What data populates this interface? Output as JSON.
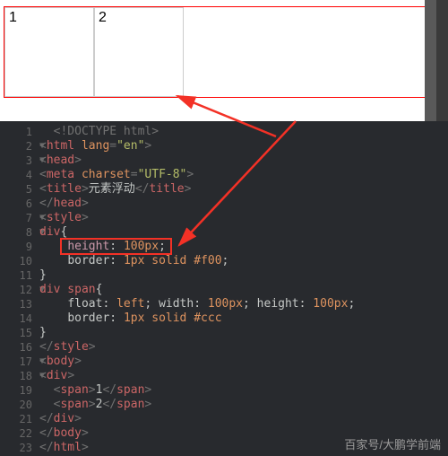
{
  "preview": {
    "span1": "1",
    "span2": "2"
  },
  "watermark": "百家号/大鹏学前端",
  "fold_glyph": "▼",
  "code": [
    {
      "n": 1,
      "fold": false,
      "tokens": [
        [
          "  ",
          "text"
        ],
        [
          "<!DOCTYPE html>",
          "doctype"
        ]
      ]
    },
    {
      "n": 2,
      "fold": true,
      "tokens": [
        [
          "<",
          "angle"
        ],
        [
          "html",
          "tag"
        ],
        [
          " ",
          "text"
        ],
        [
          "lang",
          "attr"
        ],
        [
          "=",
          "angle"
        ],
        [
          "\"en\"",
          "string"
        ],
        [
          ">",
          "angle"
        ]
      ]
    },
    {
      "n": 3,
      "fold": true,
      "tokens": [
        [
          "<",
          "angle"
        ],
        [
          "head",
          "tag"
        ],
        [
          ">",
          "angle"
        ]
      ]
    },
    {
      "n": 4,
      "fold": false,
      "tokens": [
        [
          "<",
          "angle"
        ],
        [
          "meta",
          "tag"
        ],
        [
          " ",
          "text"
        ],
        [
          "charset",
          "attr"
        ],
        [
          "=",
          "angle"
        ],
        [
          "\"UTF-8\"",
          "string"
        ],
        [
          ">",
          "angle"
        ]
      ]
    },
    {
      "n": 5,
      "fold": false,
      "tokens": [
        [
          "<",
          "angle"
        ],
        [
          "title",
          "tag"
        ],
        [
          ">",
          "angle"
        ],
        [
          "元素浮动",
          "text"
        ],
        [
          "</",
          "angle"
        ],
        [
          "title",
          "tag"
        ],
        [
          ">",
          "angle"
        ]
      ]
    },
    {
      "n": 6,
      "fold": false,
      "tokens": [
        [
          "</",
          "angle"
        ],
        [
          "head",
          "tag"
        ],
        [
          ">",
          "angle"
        ]
      ]
    },
    {
      "n": 7,
      "fold": true,
      "tokens": [
        [
          "<",
          "angle"
        ],
        [
          "style",
          "tag"
        ],
        [
          ">",
          "angle"
        ]
      ]
    },
    {
      "n": 8,
      "fold": true,
      "tokens": [
        [
          "div",
          "sel"
        ],
        [
          "{",
          "text"
        ]
      ]
    },
    {
      "n": 9,
      "fold": false,
      "tokens": [
        [
          "    ",
          "text"
        ],
        [
          "height",
          "pink"
        ],
        [
          ": ",
          "text"
        ],
        [
          "100px",
          "val"
        ],
        [
          ";",
          "text"
        ]
      ]
    },
    {
      "n": 10,
      "fold": false,
      "tokens": [
        [
          "    ",
          "text"
        ],
        [
          "border",
          "prop"
        ],
        [
          ": ",
          "text"
        ],
        [
          "1px",
          "val"
        ],
        [
          " ",
          "text"
        ],
        [
          "solid",
          "val"
        ],
        [
          " ",
          "text"
        ],
        [
          "#f00",
          "val"
        ],
        [
          ";",
          "text"
        ]
      ]
    },
    {
      "n": 11,
      "fold": false,
      "tokens": [
        [
          "}",
          "text"
        ]
      ]
    },
    {
      "n": 12,
      "fold": true,
      "tokens": [
        [
          "div span",
          "sel"
        ],
        [
          "{",
          "text"
        ]
      ]
    },
    {
      "n": 13,
      "fold": false,
      "tokens": [
        [
          "    ",
          "text"
        ],
        [
          "float",
          "prop"
        ],
        [
          ": ",
          "text"
        ],
        [
          "left",
          "val"
        ],
        [
          "; ",
          "text"
        ],
        [
          "width",
          "prop"
        ],
        [
          ": ",
          "text"
        ],
        [
          "100px",
          "val"
        ],
        [
          "; ",
          "text"
        ],
        [
          "height",
          "prop"
        ],
        [
          ": ",
          "text"
        ],
        [
          "100px",
          "val"
        ],
        [
          ";",
          "text"
        ]
      ]
    },
    {
      "n": 14,
      "fold": false,
      "tokens": [
        [
          "    ",
          "text"
        ],
        [
          "border",
          "prop"
        ],
        [
          ": ",
          "text"
        ],
        [
          "1px",
          "val"
        ],
        [
          " ",
          "text"
        ],
        [
          "solid",
          "val"
        ],
        [
          " ",
          "text"
        ],
        [
          "#ccc",
          "val"
        ]
      ]
    },
    {
      "n": 15,
      "fold": false,
      "tokens": [
        [
          "}",
          "text"
        ]
      ]
    },
    {
      "n": 16,
      "fold": false,
      "tokens": [
        [
          "</",
          "angle"
        ],
        [
          "style",
          "tag"
        ],
        [
          ">",
          "angle"
        ]
      ]
    },
    {
      "n": 17,
      "fold": true,
      "tokens": [
        [
          "<",
          "angle"
        ],
        [
          "body",
          "tag"
        ],
        [
          ">",
          "angle"
        ]
      ]
    },
    {
      "n": 18,
      "fold": true,
      "tokens": [
        [
          "<",
          "angle"
        ],
        [
          "div",
          "tag"
        ],
        [
          ">",
          "angle"
        ]
      ]
    },
    {
      "n": 19,
      "fold": false,
      "tokens": [
        [
          "  ",
          "text"
        ],
        [
          "<",
          "angle"
        ],
        [
          "span",
          "tag"
        ],
        [
          ">",
          "angle"
        ],
        [
          "1",
          "text"
        ],
        [
          "</",
          "angle"
        ],
        [
          "span",
          "tag"
        ],
        [
          ">",
          "angle"
        ]
      ]
    },
    {
      "n": 20,
      "fold": false,
      "tokens": [
        [
          "  ",
          "text"
        ],
        [
          "<",
          "angle"
        ],
        [
          "span",
          "tag"
        ],
        [
          ">",
          "angle"
        ],
        [
          "2",
          "text"
        ],
        [
          "</",
          "angle"
        ],
        [
          "span",
          "tag"
        ],
        [
          ">",
          "angle"
        ]
      ]
    },
    {
      "n": 21,
      "fold": false,
      "tokens": [
        [
          "</",
          "angle"
        ],
        [
          "div",
          "tag"
        ],
        [
          ">",
          "angle"
        ]
      ]
    },
    {
      "n": 22,
      "fold": false,
      "tokens": [
        [
          "</",
          "angle"
        ],
        [
          "body",
          "tag"
        ],
        [
          ">",
          "angle"
        ]
      ]
    },
    {
      "n": 23,
      "fold": false,
      "tokens": [
        [
          "</",
          "angle"
        ],
        [
          "html",
          "tag"
        ],
        [
          ">",
          "angle"
        ]
      ]
    }
  ]
}
